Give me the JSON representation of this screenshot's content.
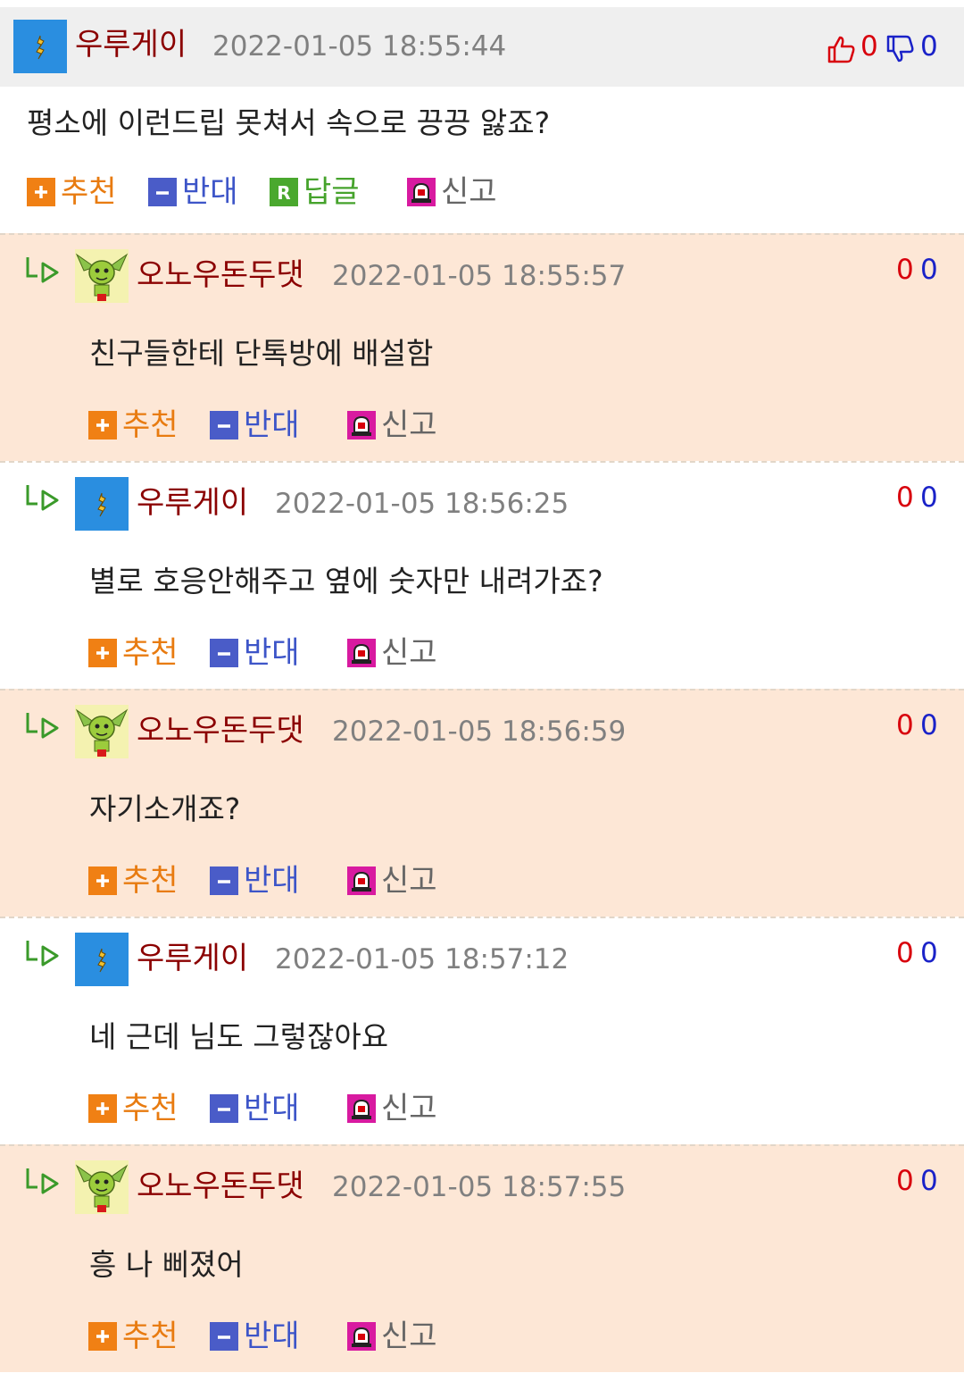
{
  "top_comment": {
    "nick": "우루게이",
    "time": "2022-01-05 18:55:44",
    "content": "평소에 이런드립 못쳐서 속으로 끙끙 앓죠?",
    "up": "0",
    "down": "0"
  },
  "actions": {
    "recommend": "추천",
    "oppose": "반대",
    "reply": "답글",
    "report": "신고"
  },
  "replies": [
    {
      "nick": "오노우돈두댓",
      "time": "2022-01-05 18:55:57",
      "content": "친구들한테 단톡방에 배설함",
      "up": "0",
      "down": "0"
    },
    {
      "nick": "우루게이",
      "time": "2022-01-05 18:56:25",
      "content": "별로 호응안해주고 옆에 숫자만 내려가죠?",
      "up": "0",
      "down": "0"
    },
    {
      "nick": "오노우돈두댓",
      "time": "2022-01-05 18:56:59",
      "content": "자기소개죠?",
      "up": "0",
      "down": "0"
    },
    {
      "nick": "우루게이",
      "time": "2022-01-05 18:57:12",
      "content": "네 근데 님도 그렇잖아요",
      "up": "0",
      "down": "0"
    },
    {
      "nick": "오노우돈두댓",
      "time": "2022-01-05 18:57:55",
      "content": "흥 나 삐졌어",
      "up": "0",
      "down": "0"
    }
  ],
  "icons": {
    "thumbs_up": "thumbs-up-icon",
    "thumbs_down": "thumbs-down-icon",
    "reply_arrow": "reply-arrow-icon",
    "plus": "plus-icon",
    "minus": "minus-icon",
    "reply_r": "reply-icon",
    "siren": "siren-icon"
  },
  "colors": {
    "nick": "#8b0000",
    "up": "#d8000c",
    "down": "#1a22c8",
    "reply_bg_alt": "#fde7d6",
    "header_bg": "#efefef"
  }
}
